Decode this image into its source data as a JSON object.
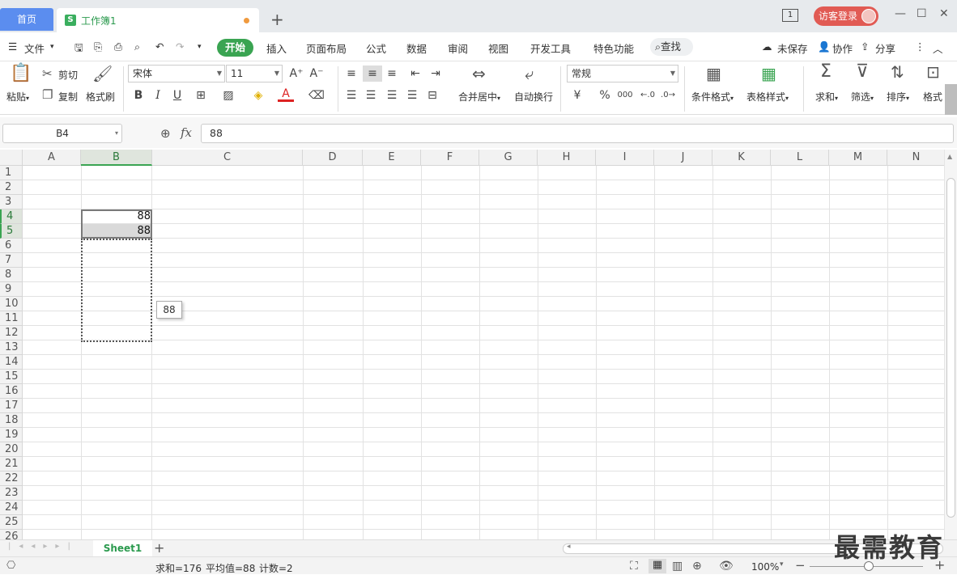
{
  "tabs": {
    "home": "首页",
    "workbook": "工作簿1",
    "workbook_icon": "S",
    "add": "+"
  },
  "titlebar": {
    "page_badge": "1",
    "login": "访客登录",
    "minimize": "—",
    "maximize": "☐",
    "close": "✕"
  },
  "menu": {
    "file": "文件",
    "items": [
      "开始",
      "插入",
      "页面布局",
      "公式",
      "数据",
      "审阅",
      "视图",
      "开发工具",
      "特色功能"
    ],
    "search": "查找",
    "unsaved": "未保存",
    "collab": "协作",
    "share": "分享"
  },
  "ribbon": {
    "paste": "粘贴",
    "cut": "剪切",
    "copy": "复制",
    "format_painter": "格式刷",
    "font_name": "宋体",
    "font_size": "11",
    "merge_center": "合并居中",
    "wrap_text": "自动换行",
    "number_format": "常规",
    "conditional_format": "条件格式",
    "table_style": "表格样式",
    "sum": "求和",
    "filter": "筛选",
    "sort": "排序",
    "format": "格式",
    "bold": "B",
    "italic": "I",
    "underline": "U",
    "font_color_letter": "A",
    "currency": "¥",
    "percent": "%",
    "thousands": "000"
  },
  "formula_bar": {
    "name_box": "B4",
    "fx": "fx",
    "value": "88"
  },
  "grid": {
    "columns": [
      "A",
      "B",
      "C",
      "D",
      "E",
      "F",
      "G",
      "H",
      "I",
      "J",
      "K",
      "L",
      "M",
      "N"
    ],
    "rows": [
      "1",
      "2",
      "3",
      "4",
      "5",
      "6",
      "7",
      "8",
      "9",
      "10",
      "11",
      "12",
      "13",
      "14",
      "15",
      "16",
      "17",
      "18",
      "19",
      "20",
      "21",
      "22",
      "23",
      "24",
      "25",
      "26"
    ],
    "cells": {
      "B4": "88",
      "B5": "88"
    },
    "fill_tooltip": "88"
  },
  "sheets": {
    "active": "Sheet1",
    "add": "+"
  },
  "status": {
    "sum": "求和=176",
    "average": "平均值=88",
    "count": "计数=2",
    "zoom": "100%"
  },
  "watermark": "最需教育",
  "colors": {
    "accent_green": "#3aa452",
    "home_tab_blue": "#5b8def",
    "login_red": "#e15b54"
  }
}
